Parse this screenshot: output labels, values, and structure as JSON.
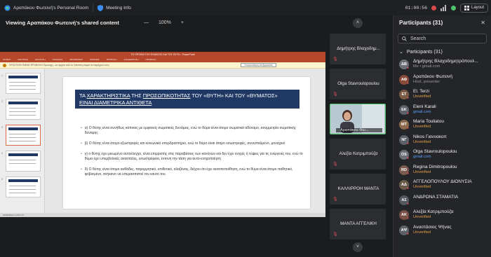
{
  "titlebar": {
    "room": "Αραπάκου Φωτεινή's Personal Room",
    "meeting_info": "Meeting Info",
    "timer": "01:00:56",
    "layout": "Layout"
  },
  "share": {
    "viewing": "Viewing Αραπάκου Φωτεινή's shared content",
    "zoom": "100%",
    "zoom_minus": "—",
    "zoom_plus": "+"
  },
  "presentation": {
    "window_title": "ΤΟ ΠΡΟΦΙΛ ΤΟΥ ΘΥΜΑΤΟΣ ΚΑΙ ΤΟΥ ΘΥΤΗ - PowerPoint",
    "ribbon": [
      "ΑΡΧΕΙΟ",
      "ΚΕΝΤΡΙΚΗ",
      "ΕΙΣΑΓΩΓΗ",
      "ΣΧΕΔΙΑΣΗ",
      "ΜΕΤΑΒΑΣΕΙΣ",
      "ΚΙΝΗΣΕΙΣ",
      "ΠΡΟΒΟΛΗ",
      "ΑΝΑΘΕΩΡΗΣΗ",
      "ΠΡΟΒΟΛΗ"
    ],
    "warning": "ΠΡΟΣΤΑΤΕΥΜΕΝΗ ΠΡΟΒΟΛΗ   Προσοχή—τα αρχεία από το Internet μπορεί να περιέχουν ιούς.",
    "warning_button": "Ενεργοποίηση επεξεργασίας",
    "status": "ΔΙΑΦΑΝΕΙΑ 3 ΑΠΟ 15",
    "slide_title_pre": "ΤΑ ",
    "slide_title_u1": "ΧΑΡΑΚΤΗΡΙΣΤΙΚΑ",
    "slide_title_mid1": " ΤΗΣ ",
    "slide_title_u2": "ΠΡΟΣΩΠΙΚΟΤΗΤΑΣ",
    "slide_title_mid2": " ΤΟΥ «ΘΥΤΗ» ΚΑΙ ΤΟΥ «ΘΥΜΑΤΟΣ» ",
    "slide_title_u3": "ΕΙΝΑΙ ΔΙΑΜΕΤΡΙΚΑ ΑΝΤΙΘΕΤΑ",
    "bullets": [
      "α) Ο θύτης είναι συνήθως κάποιος με εμφανείς σωματικές δυνάμεις, ενώ το θύμα είναι άτομο σωματικά αδύναμο, ασυμμετρία σωματικής δύναμης",
      "β) Ο θύτης είναι άτομο εξωστρεφές και κοινωνικά υπερδραστήριο, ενώ το θύμα είναι άτομο εσωστρεφές, συνεσταλμένο, μοναχικό",
      "γ) ο θύτης έχει μειωμένο αυτοέλεγχο, είναι επιρρεπής στις παραβάσεις των κανόνων και δεν έχει ενοχές ή τύψεις για τις ενέργειές του, ενώ το θύμα έχει υπερβολικές ανασταλές, εσωστρέφεια, έντονη την τάση για αυτο-ενοχοποίηση",
      "δ) Ο θύτης είναι άτομο αυθάδες, παρορμητικό, επιθετικό, αλαζόνας, δείχνει ότι έχει αυτοπεποίθηση, ενώ το θύμα είναι άτομο παθητικό, φοβισμένο, ανήκανο να υπερασπιστεί τον εαυτό του."
    ]
  },
  "strip": {
    "tiles": [
      "Δημήτρης Βλαχοδημ...",
      "Olga Stavroulopoulou",
      "Αραπάκου Φω...",
      "Αλεξία Κατριμπούζα",
      "ΚΑΛΛΙΡΡΟΗ ΜΑΝΤΑ",
      "ΜΑΝΤΑ ΑΓΓΕΛΙΚΗ"
    ]
  },
  "panel": {
    "title": "Participants (31)",
    "search_placeholder": "Search",
    "section": "Participants (31)",
    "participants": [
      {
        "initials": "ΔΒ",
        "name": "Δημήτρης Βλαχοδημητρόπουλ...",
        "status": "Me • gmail.com",
        "status_color": "gray"
      },
      {
        "initials": "ΑΦ",
        "name": "Αραπάκου Φωτεινή",
        "status": "Host, presenter",
        "status_color": "gray"
      },
      {
        "initials": "ET",
        "name": "El. Terzi",
        "status": "Unverified",
        "status_color": "orange"
      },
      {
        "initials": "EK",
        "name": "Eleni Karali",
        "status": "gmail.com",
        "status_color": "blue"
      },
      {
        "initials": "MT",
        "name": "Maria Touliatou",
        "status": "Unverified",
        "status_color": "orange"
      },
      {
        "initials": "ΝΓ",
        "name": "Nikos Γιαννακοπ",
        "status": "Unverified",
        "status_color": "orange"
      },
      {
        "initials": "OS",
        "name": "Olga Stavroulopoulou",
        "status": "gmail.com",
        "status_color": "blue"
      },
      {
        "initials": "RD",
        "name": "Regina Dimitropoulou",
        "status": "Unverified",
        "status_color": "orange"
      },
      {
        "initials": "ΑΔ",
        "name": "ΑΓΓΕΛΟΠΟΥΛΟΥ ΔΙΟΝΥΣΙΑ",
        "status": "Unverified",
        "status_color": "orange"
      },
      {
        "initials": "ΑΣ",
        "name": "ΑΝΔΡΩΝΑ ΣΤΑΜΑΤΙΑ",
        "status": "",
        "status_color": "orange"
      },
      {
        "initials": "ΑΚ",
        "name": "Αλεξία Κατριμπούζα",
        "status": "Unverified",
        "status_color": "orange"
      },
      {
        "initials": "ΑΨ",
        "name": "Αναστάσιος Ψήνας",
        "status": "Unverified",
        "status_color": "orange"
      }
    ]
  }
}
